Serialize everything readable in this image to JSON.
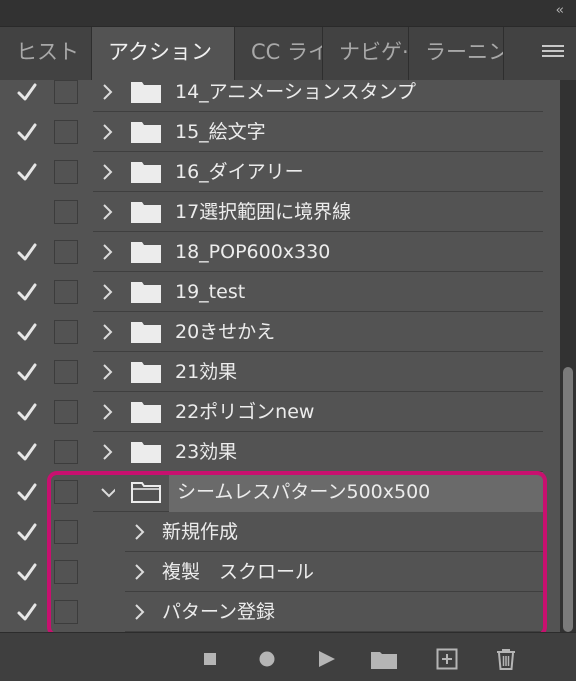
{
  "panel": {
    "collapse_label": "‹‹",
    "tabs": [
      {
        "label": "ヒスト",
        "active": false
      },
      {
        "label": "アクション",
        "active": true
      },
      {
        "label": "CC ライ",
        "active": false
      },
      {
        "label": "ナビゲ·",
        "active": false
      },
      {
        "label": "ラーニン",
        "active": false
      }
    ],
    "menu_icon": "panel-menu-icon"
  },
  "actions": [
    {
      "label": "14_アニメーションスタンプ",
      "checked": true,
      "level": 0,
      "expanded": false
    },
    {
      "label": "15_絵文字",
      "checked": true,
      "level": 0,
      "expanded": false
    },
    {
      "label": "16_ダイアリー",
      "checked": true,
      "level": 0,
      "expanded": false
    },
    {
      "label": "17選択範囲に境界線",
      "checked": false,
      "level": 0,
      "expanded": false
    },
    {
      "label": "18_POP600x330",
      "checked": true,
      "level": 0,
      "expanded": false
    },
    {
      "label": "19_test",
      "checked": true,
      "level": 0,
      "expanded": false
    },
    {
      "label": "20きせかえ",
      "checked": true,
      "level": 0,
      "expanded": false
    },
    {
      "label": "21効果",
      "checked": true,
      "level": 0,
      "expanded": false
    },
    {
      "label": "22ポリゴンnew",
      "checked": true,
      "level": 0,
      "expanded": false
    },
    {
      "label": "23効果",
      "checked": true,
      "level": 0,
      "expanded": false
    },
    {
      "label": "シームレスパターン500x500",
      "checked": true,
      "level": 0,
      "expanded": true,
      "selected": true
    },
    {
      "label": "新規作成",
      "checked": true,
      "level": 1,
      "expanded": false
    },
    {
      "label": "複製　スクロール",
      "checked": true,
      "level": 1,
      "expanded": false
    },
    {
      "label": "パターン登録",
      "checked": true,
      "level": 1,
      "expanded": false
    }
  ],
  "toolbar": {
    "icons": [
      "stop-icon",
      "record-icon",
      "play-icon",
      "new-set-folder-icon",
      "new-action-icon",
      "trash-icon"
    ]
  },
  "colors": {
    "highlight": "#c8106f",
    "panel_bg": "#535353",
    "selected_row": "#6a6a6a"
  }
}
